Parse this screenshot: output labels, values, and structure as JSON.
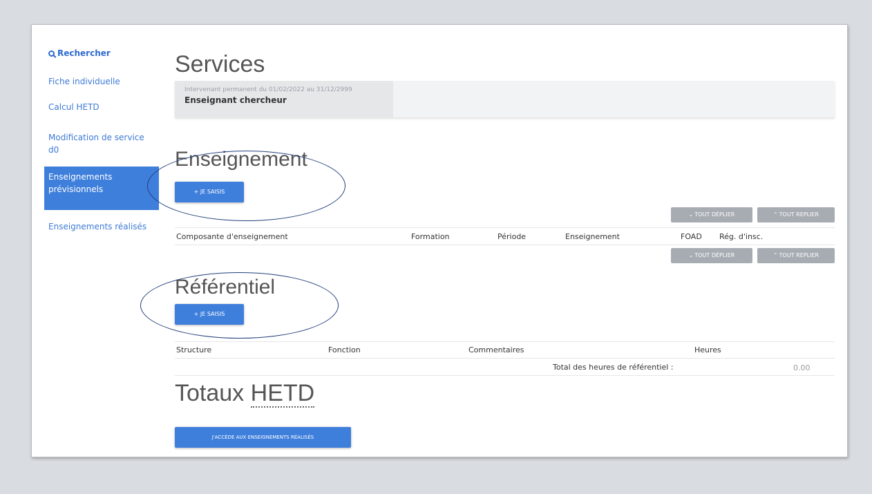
{
  "sidebar": {
    "search": "Rechercher",
    "items": [
      "Fiche individuelle",
      "Calcul HETD",
      "Modification de service",
      "d0",
      "Enseignements",
      "prévisionnels",
      "Enseignements réalisés"
    ]
  },
  "page": {
    "title": "Services",
    "info_small": "Intervenant permanent du 01/02/2022 au 31/12/2999",
    "info_big": "Enseignant chercheur"
  },
  "enseignement": {
    "title": "Enseignement",
    "add_label": "+ JE SAISIS",
    "expand_label": "TOUT DÉPLIER",
    "collapse_label": "TOUT REPLIER",
    "columns": [
      "Composante d'enseignement",
      "Formation",
      "Période",
      "Enseignement",
      "FOAD",
      "Rég. d'insc."
    ]
  },
  "referentiel": {
    "title": "Référentiel",
    "add_label": "+ JE SAISIS",
    "columns": [
      "Structure",
      "Fonction",
      "Commentaires",
      "Heures"
    ],
    "total_label": "Total des heures de référentiel :",
    "total_value": "0.00"
  },
  "totaux": {
    "title_prefix": "Totaux",
    "title_abbr": "HETD",
    "realises_label": "J'ACCÈDE AUX ENSEIGNEMENTS RÉALISÉS"
  },
  "colors": {
    "accent": "#3f7fdc",
    "grey_button": "#a7acb3",
    "ellipse": "#1f3d7a"
  }
}
